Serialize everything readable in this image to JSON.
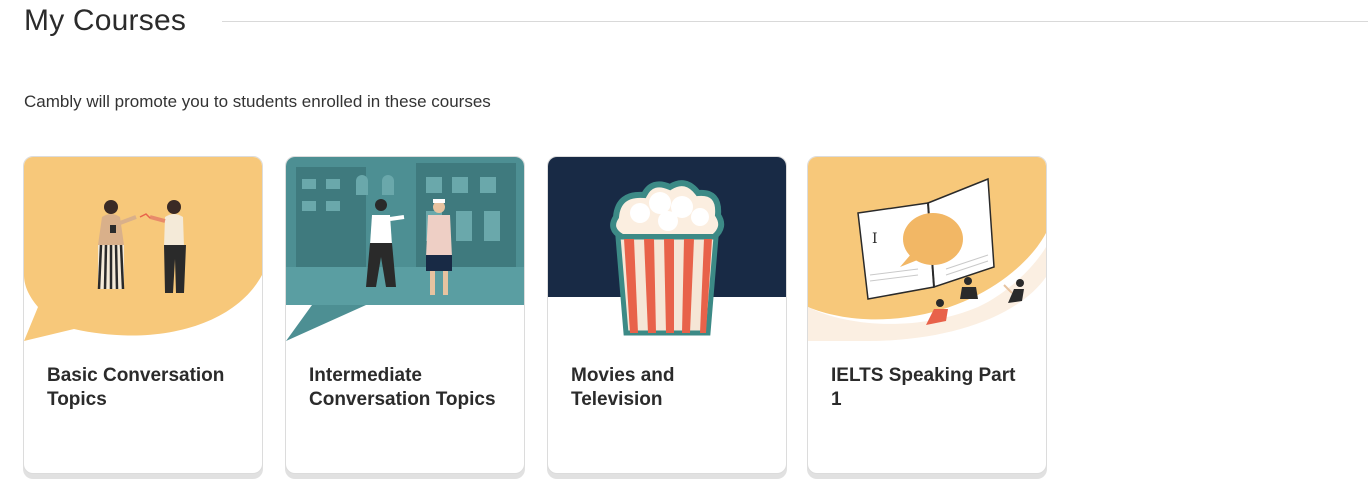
{
  "page": {
    "title": "My Courses",
    "subtitle": "Cambly will promote you to students enrolled in these courses"
  },
  "courses": [
    {
      "title": "Basic Conversation Topics",
      "illustration": "two-people-chatting-speech-bubble"
    },
    {
      "title": "Intermediate Conversation Topics",
      "illustration": "people-on-city-street"
    },
    {
      "title": "Movies and Television",
      "illustration": "popcorn-bucket"
    },
    {
      "title": "IELTS Speaking Part 1",
      "illustration": "open-book-students"
    }
  ],
  "colors": {
    "yellow": "#f7c87a",
    "teal": "#4d8f93",
    "navy": "#182a45",
    "popcorn_red": "#e8624a",
    "card_border": "#dcdcdc"
  }
}
